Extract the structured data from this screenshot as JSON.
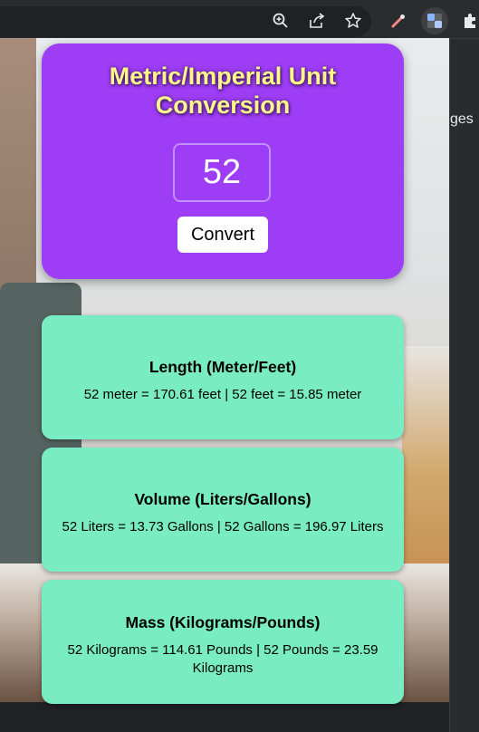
{
  "browser": {
    "icons": [
      "zoom-icon",
      "share-icon",
      "bookmark-star-icon",
      "eyedropper-extension-icon",
      "translate-extension-icon",
      "extensions-puzzle-icon"
    ],
    "side_panel_text": "ges"
  },
  "converter": {
    "title": "Metric/Imperial Unit Conversion",
    "input_value": "52",
    "button_label": "Convert",
    "accent_color": "#9d3df5",
    "title_color": "#fff78a"
  },
  "results": [
    {
      "title": "Length (Meter/Feet)",
      "text": "52 meter = 170.61 feet | 52 feet = 15.85 meter"
    },
    {
      "title": "Volume (Liters/Gallons)",
      "text": "52 Liters = 13.73 Gallons | 52 Gallons = 196.97 Liters"
    },
    {
      "title": "Mass (Kilograms/Pounds)",
      "text": "52 Kilograms = 114.61 Pounds | 52 Pounds = 23.59 Kilograms"
    }
  ],
  "card_color": "#79ecc3"
}
